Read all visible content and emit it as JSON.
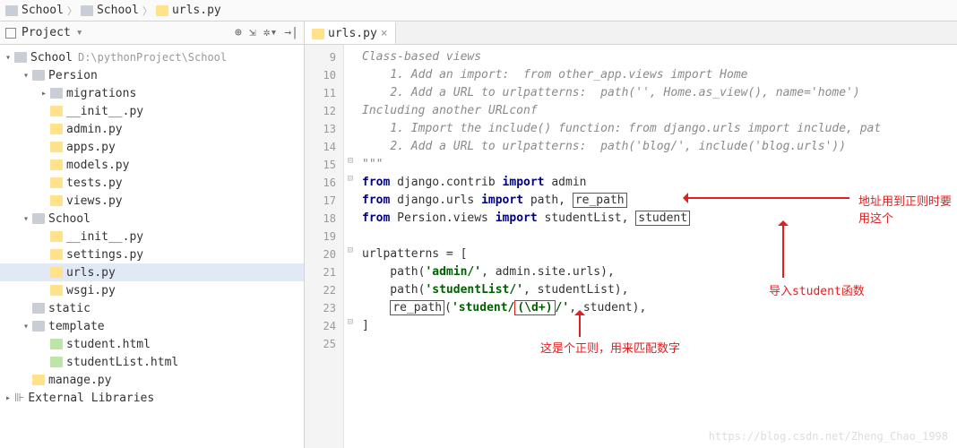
{
  "breadcrumbs": [
    {
      "label": "School",
      "icon": "folder"
    },
    {
      "label": "School",
      "icon": "folder"
    },
    {
      "label": "urls.py",
      "icon": "py"
    }
  ],
  "sidebar": {
    "title": "Project",
    "tree": [
      {
        "ind": 0,
        "caret": "▾",
        "icon": "folder",
        "label": "School",
        "path": "D:\\pythonProject\\School",
        "sel": false
      },
      {
        "ind": 1,
        "caret": "▾",
        "icon": "folder",
        "label": "Persion"
      },
      {
        "ind": 2,
        "caret": "▸",
        "icon": "folder",
        "label": "migrations"
      },
      {
        "ind": 2,
        "caret": "",
        "icon": "py",
        "label": "__init__.py"
      },
      {
        "ind": 2,
        "caret": "",
        "icon": "py",
        "label": "admin.py"
      },
      {
        "ind": 2,
        "caret": "",
        "icon": "py",
        "label": "apps.py"
      },
      {
        "ind": 2,
        "caret": "",
        "icon": "py",
        "label": "models.py"
      },
      {
        "ind": 2,
        "caret": "",
        "icon": "py",
        "label": "tests.py"
      },
      {
        "ind": 2,
        "caret": "",
        "icon": "py",
        "label": "views.py"
      },
      {
        "ind": 1,
        "caret": "▾",
        "icon": "folder",
        "label": "School"
      },
      {
        "ind": 2,
        "caret": "",
        "icon": "py",
        "label": "__init__.py"
      },
      {
        "ind": 2,
        "caret": "",
        "icon": "py",
        "label": "settings.py"
      },
      {
        "ind": 2,
        "caret": "",
        "icon": "py",
        "label": "urls.py",
        "sel": true
      },
      {
        "ind": 2,
        "caret": "",
        "icon": "py",
        "label": "wsgi.py"
      },
      {
        "ind": 1,
        "caret": "",
        "icon": "folder",
        "label": "static"
      },
      {
        "ind": 1,
        "caret": "▾",
        "icon": "folder",
        "label": "template"
      },
      {
        "ind": 2,
        "caret": "",
        "icon": "html",
        "label": "student.html"
      },
      {
        "ind": 2,
        "caret": "",
        "icon": "html",
        "label": "studentList.html"
      },
      {
        "ind": 1,
        "caret": "",
        "icon": "py",
        "label": "manage.py"
      },
      {
        "ind": 0,
        "caret": "▸",
        "icon": "lib",
        "label": "External Libraries"
      }
    ]
  },
  "tabs": [
    {
      "label": "urls.py",
      "active": true
    }
  ],
  "code": {
    "first_line": 9,
    "lines": [
      {
        "n": 9,
        "html": "<span class='cm-c'>Class-based views</span>"
      },
      {
        "n": 10,
        "html": "    <span class='cm-c'>1. Add an import:  from other_app.views import Home</span>"
      },
      {
        "n": 11,
        "html": "    <span class='cm-c'>2. Add a URL to urlpatterns:  path('', Home.as_view(), name='home')</span>"
      },
      {
        "n": 12,
        "html": "<span class='cm-c'>Including another URLconf</span>"
      },
      {
        "n": 13,
        "html": "    <span class='cm-c'>1. Import the include() function: from django.urls import include, pat</span>"
      },
      {
        "n": 14,
        "html": "    <span class='cm-c'>2. Add a URL to urlpatterns:  path('blog/', include('blog.urls'))</span>"
      },
      {
        "n": 15,
        "html": "<span class='cm-c'>\"\"\"</span>"
      },
      {
        "n": 16,
        "html": "<span class='cm-k'>from</span> django.contrib <span class='cm-k'>import</span> admin"
      },
      {
        "n": 17,
        "html": "<span class='cm-k'>from</span> django.urls <span class='cm-k'>import</span> path, <span class='box-red'>re_path</span>"
      },
      {
        "n": 18,
        "html": "<span class='cm-k'>from</span> Persion.views <span class='cm-k'>import</span> studentList, <span class='box-red'>student</span>"
      },
      {
        "n": 19,
        "html": ""
      },
      {
        "n": 20,
        "html": "urlpatterns = ["
      },
      {
        "n": 21,
        "html": "    path(<span class='cm-s'>'admin/'</span>, admin.site.urls),"
      },
      {
        "n": 22,
        "html": "    path(<span class='cm-s'>'studentList/'</span>, studentList),"
      },
      {
        "n": 23,
        "html": "    <span class='box-red'>re_path</span>(<span class='cm-s'>'student/</span><span class='box-red cm-s'>(\\d+)</span><span class='cm-s'>/'</span>, student),"
      },
      {
        "n": 24,
        "html": "]"
      },
      {
        "n": 25,
        "html": ""
      }
    ]
  },
  "annotations": {
    "a1": "地址用到正则时要用这个",
    "a2": "导入student函数",
    "a3": "这是个正则，用来匹配数字"
  },
  "watermark": "https://blog.csdn.net/Zheng_Chao_1998"
}
